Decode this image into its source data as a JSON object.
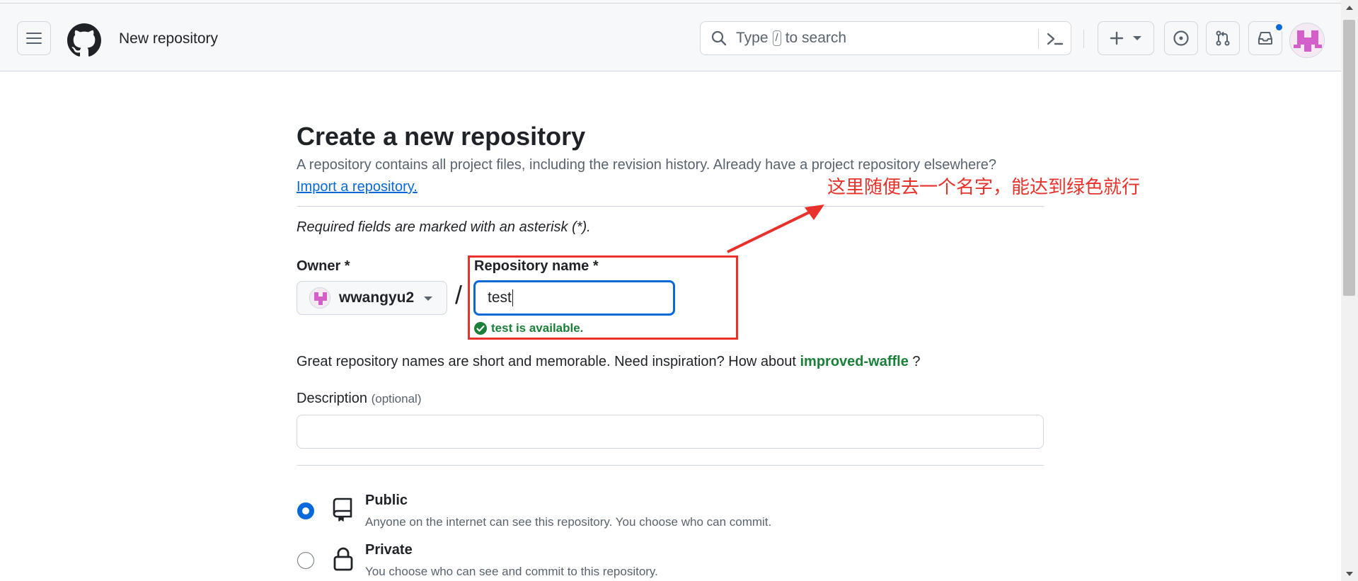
{
  "header": {
    "title": "New repository",
    "search": {
      "prefix": "Type",
      "kbd": "/",
      "suffix": "to search"
    }
  },
  "main": {
    "heading": "Create a new repository",
    "subtitle": "A repository contains all project files, including the revision history. Already have a project repository elsewhere?",
    "import_link": "Import a repository.",
    "required_note": "Required fields are marked with an asterisk (*).",
    "owner_label": "Owner *",
    "owner_value": "wwangyu2",
    "separator": "/",
    "repo_name_label": "Repository name *",
    "repo_name_value": "test",
    "availability": "test is available.",
    "inspiration_prefix": "Great repository names are short and memorable. Need inspiration? How about",
    "inspiration_suggestion": "improved-waffle",
    "inspiration_suffix": "?",
    "description_label": "Description",
    "description_optional": "(optional)",
    "description_value": "",
    "visibility": [
      {
        "title": "Public",
        "desc": "Anyone on the internet can see this repository. You choose who can commit.",
        "selected": true,
        "icon": "repo-icon"
      },
      {
        "title": "Private",
        "desc": "You choose who can see and commit to this repository.",
        "selected": false,
        "icon": "lock-icon"
      }
    ]
  },
  "annotation": {
    "text": "这里随便去一个名字，能达到绿色就行",
    "color": "#e8312a"
  },
  "colors": {
    "accent": "#0969da",
    "success": "#1a7f37",
    "muted": "#59636e"
  }
}
